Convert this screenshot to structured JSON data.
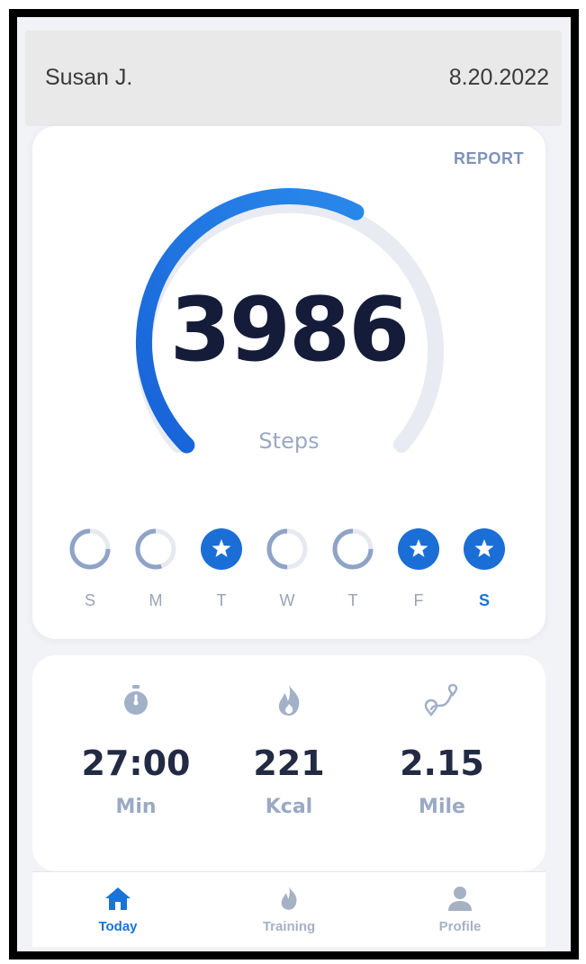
{
  "header": {
    "user_name": "Susan J.",
    "date": "8.20.2022"
  },
  "activity": {
    "report_label": "REPORT",
    "steps_value": "3986",
    "steps_label": "Steps",
    "steps_goal_progress": 0.6,
    "colors": {
      "accent": "#1a73d6",
      "track": "#e8ebf1"
    }
  },
  "week": [
    {
      "label": "S",
      "status": "partial",
      "progress": 0.75,
      "active": false
    },
    {
      "label": "M",
      "status": "partial",
      "progress": 0.55,
      "active": false
    },
    {
      "label": "T",
      "status": "goal",
      "progress": 1,
      "active": false
    },
    {
      "label": "W",
      "status": "partial",
      "progress": 0.5,
      "active": false
    },
    {
      "label": "T",
      "status": "partial",
      "progress": 0.75,
      "active": false
    },
    {
      "label": "F",
      "status": "goal",
      "progress": 1,
      "active": false
    },
    {
      "label": "S",
      "status": "goal",
      "progress": 1,
      "active": true
    }
  ],
  "stats": [
    {
      "icon": "stopwatch-icon",
      "value": "27:00",
      "unit": "Min"
    },
    {
      "icon": "flame-icon",
      "value": "221",
      "unit": "Kcal"
    },
    {
      "icon": "route-icon",
      "value": "2.15",
      "unit": "Mile"
    }
  ],
  "tabs": [
    {
      "icon": "home-icon",
      "label": "Today",
      "active": true
    },
    {
      "icon": "flame-icon",
      "label": "Training",
      "active": false
    },
    {
      "icon": "person-icon",
      "label": "Profile",
      "active": false
    }
  ]
}
